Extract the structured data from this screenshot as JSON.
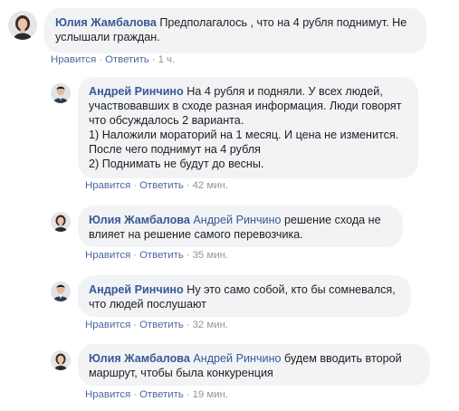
{
  "ui": {
    "like_label": "Нравится",
    "reply_label": "Ответить",
    "separator": "·"
  },
  "comments": [
    {
      "author": "Юлия Жамбалова",
      "mention": "",
      "text": " Предполагалось , что на 4 рубля поднимут. Не услышали граждан.",
      "time": "1 ч.",
      "avatar": "woman-avatar"
    },
    {
      "author": "Андрей Ринчино",
      "mention": "",
      "text": " На 4 рубля и подняли. У всех людей, участвовавших в сходе разная информация. Люди говорят что обсуждалось 2 варианта.\n1) Наложили мораторий на 1 месяц. И цена не изменится. После чего поднимут на 4 рубля\n2) Поднимать не будут до весны.",
      "time": "42 мин.",
      "avatar": "man-avatar"
    },
    {
      "author": "Юлия Жамбалова",
      "mention": " Андрей Ринчино",
      "text": " решение схода не влияет на решение самого перевозчика.",
      "time": "35 мин.",
      "avatar": "woman-avatar"
    },
    {
      "author": "Андрей Ринчино",
      "mention": "",
      "text": " Ну это само собой, кто бы сомневался, что людей послушают",
      "time": "32 мин.",
      "avatar": "man-avatar"
    },
    {
      "author": "Юлия Жамбалова",
      "mention": " Андрей Ринчино",
      "text": " будем вводить второй маршрут, чтобы была конкуренция",
      "time": "19 мин.",
      "avatar": "woman-avatar"
    }
  ]
}
